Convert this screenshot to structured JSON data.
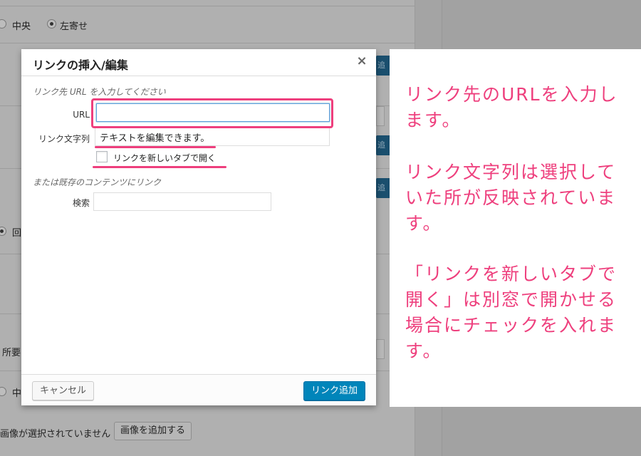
{
  "background": {
    "align_center": "中央",
    "align_left": "左寄せ",
    "partial_text_1": "回",
    "partial_text_2": "所要",
    "partial_text_3": "中",
    "no_image_text": "画像が選択されていません",
    "add_image_button": "画像を追加する",
    "partial_blue_button": "追加"
  },
  "dialog": {
    "title": "リンクの挿入/編集",
    "close_glyph": "×",
    "url_section_label": "リンク先 URL を入力してください",
    "url_label": "URL",
    "url_value": "",
    "link_text_label": "リンク文字列",
    "link_text_value": "テキストを編集できます。",
    "new_tab_label": "リンクを新しいタブで開く",
    "new_tab_checked": false,
    "existing_content_label": "または既存のコンテンツにリンク",
    "search_label": "検索",
    "search_value": "",
    "cancel_button": "キャンセル",
    "add_link_button": "リンク追加"
  },
  "annotations": {
    "note_1": "リンク先のURLを入力します。",
    "note_2": "リンク文字列は選択していた所が反映されています。",
    "note_3": "「リンクを新しいタブで開く」は別窓で開かせる場合にチェックを入れます。"
  },
  "colors": {
    "highlight": "#ee3f7d",
    "primary_button": "#0085ba",
    "overlay": "#a9a9a9"
  }
}
